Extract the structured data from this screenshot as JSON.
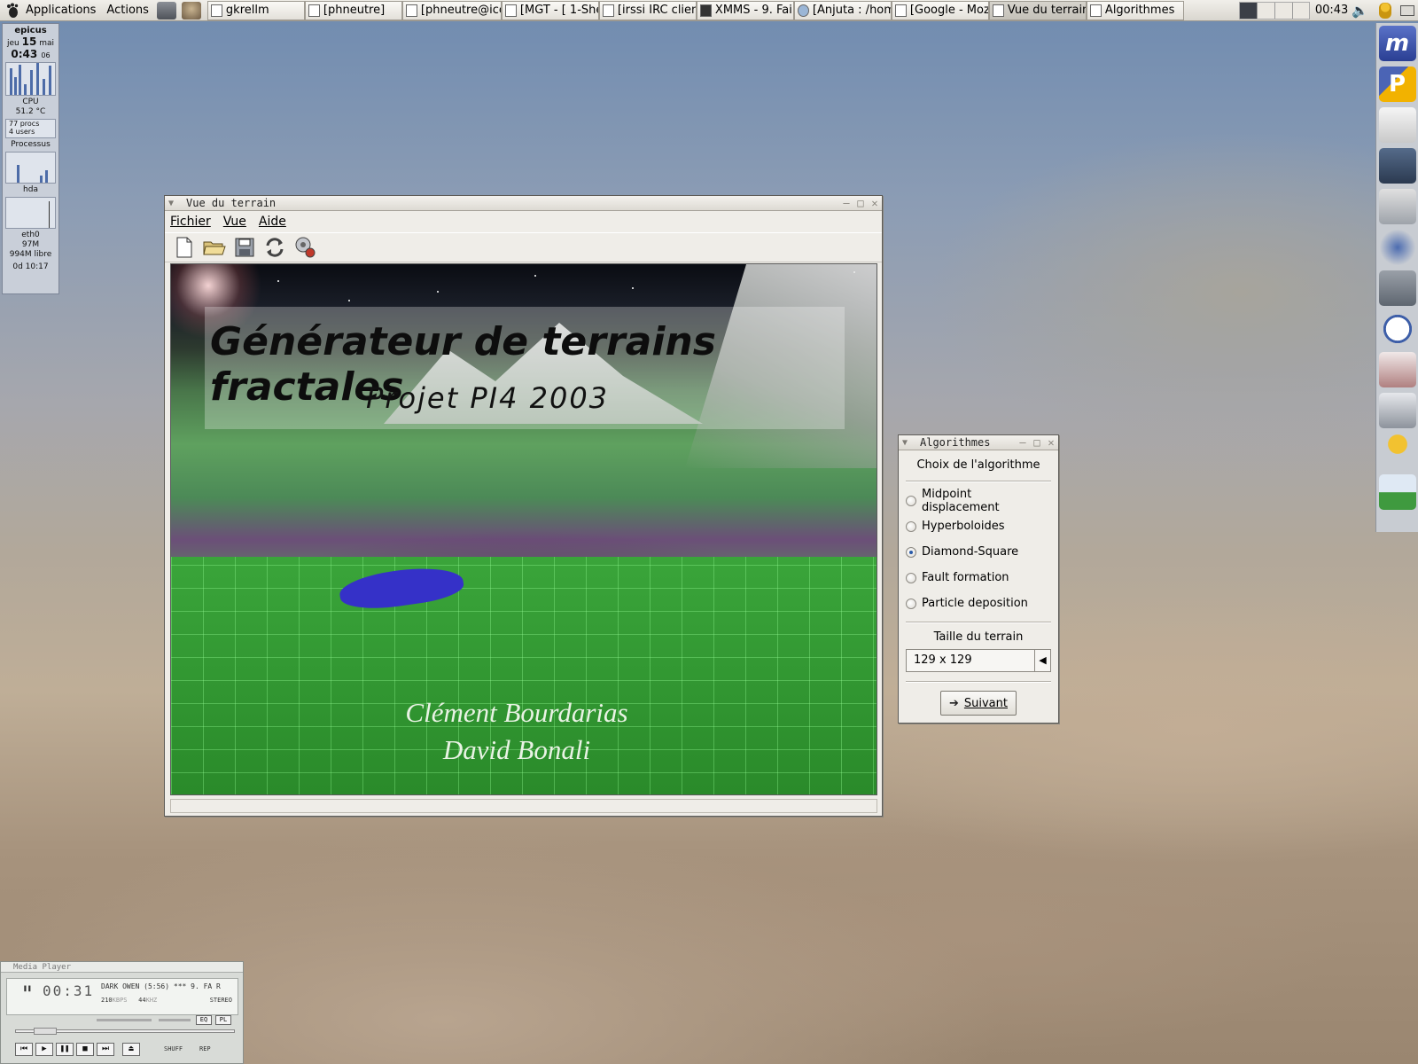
{
  "top_panel": {
    "applications_label": "Applications",
    "actions_label": "Actions",
    "tasks": [
      {
        "label": "gkrellm"
      },
      {
        "label": "[phneutre]"
      },
      {
        "label": "[phneutre@icc"
      },
      {
        "label": "[MGT - [ 1-She"
      },
      {
        "label": "[irssi IRC clien"
      },
      {
        "label": "XMMS - 9. Fai"
      },
      {
        "label": "[Anjuta : /home"
      },
      {
        "label": "[Google - Moz"
      },
      {
        "label": "Vue du terrain"
      },
      {
        "label": "Algorithmes"
      }
    ],
    "clock": "00:43"
  },
  "gkrellm": {
    "hostname": "epicus",
    "date_day": "jeu",
    "date_num": "15",
    "date_month": "mai",
    "time": "0:43",
    "time_sec": "06",
    "cpu_label": "CPU",
    "cpu_temp": "51.2 °C",
    "procs": "77 procs",
    "users": "4 users",
    "processus_label": "Processus",
    "hda_label": "hda",
    "eth0_label": "eth0",
    "mem_used": "97M",
    "mem_free": "994M libre",
    "uptime": "0d 10:17"
  },
  "main_window": {
    "title": "Vue du terrain",
    "menu": [
      {
        "label": "Fichier"
      },
      {
        "label": "Vue"
      },
      {
        "label": "Aide"
      }
    ],
    "toolbar_icons": [
      "new-file-icon",
      "open-folder-icon",
      "save-icon",
      "refresh-icon",
      "render-icon"
    ],
    "splash": {
      "title": "Générateur de terrains fractales",
      "subtitle": "Projet PI4 2003",
      "author1": "Clément Bourdarias",
      "author2": "David Bonali"
    }
  },
  "algo_window": {
    "title": "Algorithmes",
    "heading": "Choix de l'algorithme",
    "options": [
      {
        "label": "Midpoint displacement",
        "checked": false
      },
      {
        "label": "Hyperboloides",
        "checked": false
      },
      {
        "label": "Diamond-Square",
        "checked": true
      },
      {
        "label": "Fault formation",
        "checked": false
      },
      {
        "label": "Particle deposition",
        "checked": false
      }
    ],
    "size_label": "Taille du terrain",
    "size_value": "129 x 129",
    "next_label": "Suivant"
  },
  "media_player": {
    "title": "Media Player",
    "time": "00:31",
    "song": "DARK OWEN (5:56)  ***  9. FA R",
    "kbps": "210",
    "kbps_unit": "KBPS",
    "khz": "44",
    "khz_unit": "KHZ",
    "stereo": "STEREO",
    "eq_label": "EQ",
    "pl_label": "PL",
    "shuffle_label": "SHUFF",
    "repeat_label": "REP"
  },
  "colors": {
    "window_bg": "#efede8",
    "radio_checked": "#2a5aa8",
    "canvas_green": "#3aa53a"
  }
}
